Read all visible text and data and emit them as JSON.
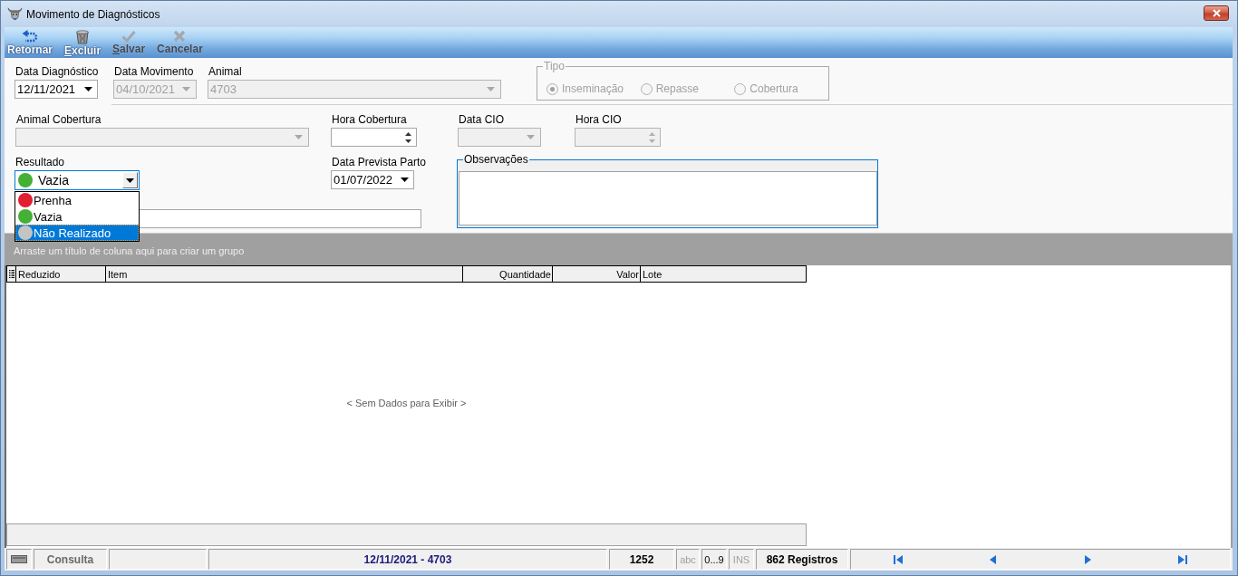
{
  "window": {
    "title": "Movimento de Diagnósticos"
  },
  "toolbar": [
    {
      "label": "Retornar",
      "kind": "return",
      "disabled": false,
      "underlined_first": false
    },
    {
      "label": "Excluir",
      "kind": "delete",
      "disabled": false,
      "underlined_first": true
    },
    {
      "label": "Salvar",
      "kind": "save",
      "disabled": true,
      "underlined_first": true
    },
    {
      "label": "Cancelar",
      "kind": "cancel",
      "disabled": true,
      "underlined_first": false
    }
  ],
  "row_1": {
    "fields": [
      {
        "kind": "date",
        "label": "Data Diagnóstico",
        "value": "12/11/2021",
        "disabled": false
      },
      {
        "kind": "date",
        "label": "Data Movimento",
        "value": "04/10/2021",
        "disabled": true
      },
      {
        "kind": "combo",
        "label": "Animal",
        "value": "4703",
        "disabled": true
      }
    ],
    "tipo": {
      "legend": "Tipo",
      "disabled": true,
      "options": [
        {
          "label": "Inseminação",
          "selected": true
        },
        {
          "label": "Repasse",
          "selected": false
        },
        {
          "label": "Cobertura",
          "selected": false
        }
      ]
    }
  },
  "row_2": {
    "fields": [
      {
        "kind": "combo",
        "label": "Animal Cobertura",
        "disabled": true
      },
      {
        "kind": "spin",
        "label": "Hora Cobertura",
        "disabled": false
      },
      {
        "kind": "date",
        "label": "Data CIO",
        "disabled": true
      },
      {
        "kind": "spin",
        "label": "Hora CIO",
        "disabled": true
      }
    ]
  },
  "row_3": {
    "resultado": {
      "label": "Resultado",
      "value": {
        "label": "Vazia",
        "color": "#44b035"
      },
      "focused": true,
      "expanded": true,
      "options": [
        {
          "label": "Prenha",
          "color": "#e02030",
          "selected": false
        },
        {
          "label": "Vazia",
          "color": "#44b035",
          "selected": false
        },
        {
          "label": "Não Realizado",
          "color": "#c4c4c4",
          "selected": true
        }
      ]
    },
    "data_prevista_parto": {
      "kind": "date",
      "label": "Data Prevista Parto",
      "value": "01/07/2022",
      "disabled": false
    },
    "text_field": {
      "kind": "text",
      "disabled": false
    },
    "observacoes": {
      "legend": "Observações",
      "focused": true
    }
  },
  "grid": {
    "group_hint": "Arraste um título de coluna aqui para criar um grupo",
    "columns": [
      {
        "label": "Reduzido",
        "kind": "text"
      },
      {
        "label": "Item",
        "kind": "text"
      },
      {
        "label": "Quantidade",
        "kind": "numeric"
      },
      {
        "label": "Valor",
        "kind": "numeric"
      },
      {
        "label": "Lote",
        "kind": "text"
      }
    ],
    "empty_text": "< Sem Dados para Exibir >"
  },
  "status_bar": {
    "mode": "Consulta",
    "record": "12/11/2021 - 4703",
    "code": "1252",
    "indicators": [
      {
        "label": "abc",
        "on": false
      },
      {
        "label": "0...9",
        "on": true
      },
      {
        "label": "INS",
        "on": false
      }
    ],
    "count": "862 Registros",
    "nav": [
      {
        "kind": "first"
      },
      {
        "kind": "prev"
      },
      {
        "kind": "next"
      },
      {
        "kind": "last"
      }
    ]
  }
}
